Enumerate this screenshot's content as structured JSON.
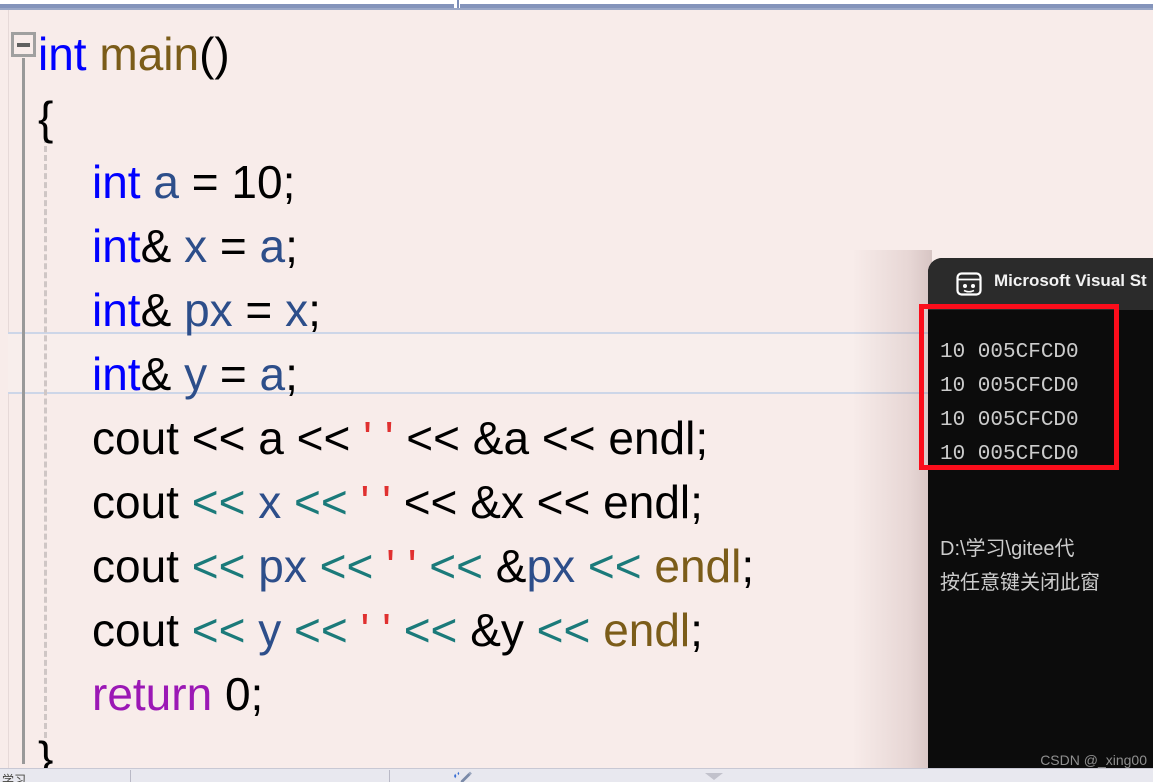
{
  "app": {
    "name": "Microsoft Visual Studio",
    "theme_bg": "#f8ecea",
    "accent": "#8494bb"
  },
  "editor": {
    "fold_marker": "minus",
    "current_line_index": 5,
    "lines": [
      {
        "indent": 0,
        "tokens": [
          {
            "text": "int",
            "cls": "kw"
          },
          {
            "text": " ",
            "cls": "plain"
          },
          {
            "text": "main",
            "cls": "fn"
          },
          {
            "text": "()",
            "cls": "plain"
          }
        ]
      },
      {
        "indent": 1,
        "tokens": [
          {
            "text": "{",
            "cls": "plain"
          }
        ]
      },
      {
        "indent": 2,
        "tokens": [
          {
            "text": "int",
            "cls": "kw"
          },
          {
            "text": " ",
            "cls": "plain"
          },
          {
            "text": "a",
            "cls": "var"
          },
          {
            "text": " = ",
            "cls": "plain"
          },
          {
            "text": "10",
            "cls": "num"
          },
          {
            "text": ";",
            "cls": "plain"
          }
        ]
      },
      {
        "indent": 2,
        "tokens": [
          {
            "text": "int",
            "cls": "kw"
          },
          {
            "text": "& ",
            "cls": "plain"
          },
          {
            "text": "x",
            "cls": "var"
          },
          {
            "text": " = ",
            "cls": "plain"
          },
          {
            "text": "a",
            "cls": "var"
          },
          {
            "text": ";",
            "cls": "plain"
          }
        ]
      },
      {
        "indent": 2,
        "tokens": [
          {
            "text": "int",
            "cls": "kw"
          },
          {
            "text": "& ",
            "cls": "plain"
          },
          {
            "text": "px",
            "cls": "var"
          },
          {
            "text": " = ",
            "cls": "plain"
          },
          {
            "text": "x",
            "cls": "var"
          },
          {
            "text": ";",
            "cls": "plain"
          }
        ]
      },
      {
        "indent": 2,
        "tokens": [
          {
            "text": "int",
            "cls": "kw"
          },
          {
            "text": "& ",
            "cls": "plain"
          },
          {
            "text": "y",
            "cls": "var"
          },
          {
            "text": " = ",
            "cls": "plain"
          },
          {
            "text": "a",
            "cls": "var"
          },
          {
            "text": ";",
            "cls": "plain"
          }
        ]
      },
      {
        "indent": 2,
        "tokens": [
          {
            "text": "cout ",
            "cls": "plain"
          },
          {
            "text": "<<",
            "cls": "op"
          },
          {
            "text": " a ",
            "cls": "plain"
          },
          {
            "text": "<<",
            "cls": "op"
          },
          {
            "text": " ",
            "cls": "plain"
          },
          {
            "text": "' '",
            "cls": "str"
          },
          {
            "text": " ",
            "cls": "plain"
          },
          {
            "text": "<<",
            "cls": "op"
          },
          {
            "text": " &a ",
            "cls": "plain"
          },
          {
            "text": "<<",
            "cls": "op"
          },
          {
            "text": " endl",
            "cls": "plain"
          },
          {
            "text": ";",
            "cls": "plain"
          }
        ]
      },
      {
        "indent": 2,
        "tokens": [
          {
            "text": "cout ",
            "cls": "plain"
          },
          {
            "text": "<<",
            "cls": "op-teal"
          },
          {
            "text": " ",
            "cls": "plain"
          },
          {
            "text": "x",
            "cls": "var"
          },
          {
            "text": " ",
            "cls": "plain"
          },
          {
            "text": "<<",
            "cls": "op-teal"
          },
          {
            "text": " ",
            "cls": "plain"
          },
          {
            "text": "' '",
            "cls": "str"
          },
          {
            "text": " ",
            "cls": "plain"
          },
          {
            "text": "<<",
            "cls": "op"
          },
          {
            "text": " &x ",
            "cls": "plain"
          },
          {
            "text": "<<",
            "cls": "op"
          },
          {
            "text": " endl",
            "cls": "plain"
          },
          {
            "text": ";",
            "cls": "plain"
          }
        ]
      },
      {
        "indent": 2,
        "tokens": [
          {
            "text": "cout ",
            "cls": "plain"
          },
          {
            "text": "<<",
            "cls": "op-teal"
          },
          {
            "text": " ",
            "cls": "plain"
          },
          {
            "text": "px",
            "cls": "var"
          },
          {
            "text": " ",
            "cls": "plain"
          },
          {
            "text": "<<",
            "cls": "op-teal"
          },
          {
            "text": " ",
            "cls": "plain"
          },
          {
            "text": "' '",
            "cls": "str"
          },
          {
            "text": " ",
            "cls": "plain"
          },
          {
            "text": "<<",
            "cls": "op-teal"
          },
          {
            "text": " &",
            "cls": "plain"
          },
          {
            "text": "px",
            "cls": "var"
          },
          {
            "text": " ",
            "cls": "plain"
          },
          {
            "text": "<<",
            "cls": "op-teal"
          },
          {
            "text": " ",
            "cls": "plain"
          },
          {
            "text": "endl",
            "cls": "endl-br"
          },
          {
            "text": ";",
            "cls": "plain"
          }
        ]
      },
      {
        "indent": 2,
        "tokens": [
          {
            "text": "cout ",
            "cls": "plain"
          },
          {
            "text": "<<",
            "cls": "op-teal"
          },
          {
            "text": " ",
            "cls": "plain"
          },
          {
            "text": "y",
            "cls": "var"
          },
          {
            "text": " ",
            "cls": "plain"
          },
          {
            "text": "<<",
            "cls": "op-teal"
          },
          {
            "text": " ",
            "cls": "plain"
          },
          {
            "text": "' '",
            "cls": "str"
          },
          {
            "text": " ",
            "cls": "plain"
          },
          {
            "text": "<<",
            "cls": "op-teal"
          },
          {
            "text": " &y ",
            "cls": "plain"
          },
          {
            "text": "<<",
            "cls": "op-teal"
          },
          {
            "text": " ",
            "cls": "plain"
          },
          {
            "text": "endl",
            "cls": "endl-br"
          },
          {
            "text": ";",
            "cls": "plain"
          }
        ]
      },
      {
        "indent": 2,
        "tokens": [
          {
            "text": "return",
            "cls": "kw-ret"
          },
          {
            "text": " ",
            "cls": "plain"
          },
          {
            "text": "0",
            "cls": "num"
          },
          {
            "text": ";",
            "cls": "plain"
          }
        ]
      },
      {
        "indent": 1,
        "tokens": [
          {
            "text": "}",
            "cls": "plain"
          }
        ]
      }
    ]
  },
  "console": {
    "title": "Microsoft Visual St",
    "icon": "console-window-icon",
    "output_lines": [
      "10 005CFCD0",
      "10 005CFCD0",
      "10 005CFCD0",
      "10 005CFCD0"
    ],
    "path_line": "D:\\学习\\gitee代",
    "prompt_line": "按任意键关闭此窗",
    "watermark": "CSDN @_xing00"
  },
  "annotation": {
    "shape": "rectangle",
    "color": "#fb0d1b"
  },
  "status_bar": {
    "text": "学习",
    "icon": "sparkle-pencil-icon"
  }
}
